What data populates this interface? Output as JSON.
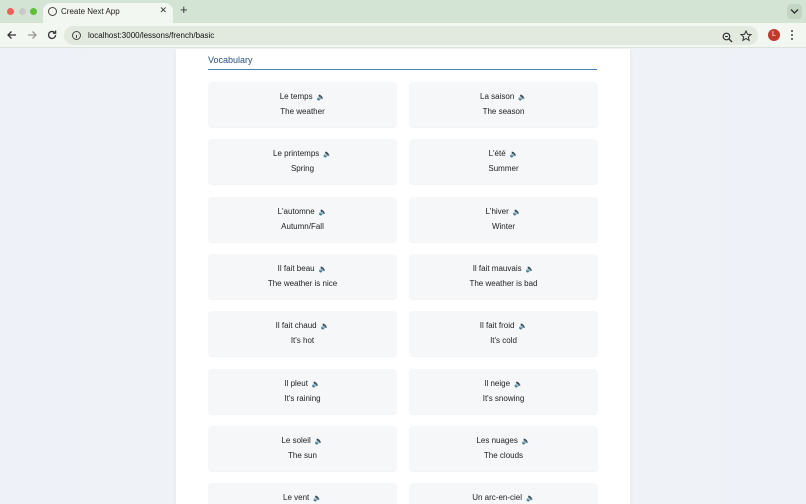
{
  "browser": {
    "tab_title": "Create Next App",
    "tab_close": "✕",
    "new_tab": "+",
    "url": "localhost:3000/lessons/french/basic",
    "profile_initial": "L"
  },
  "lesson": {
    "section_title": "Vocabulary",
    "speaker_icon": "🔈",
    "items": [
      {
        "fr": "Le temps",
        "en": "The weather"
      },
      {
        "fr": "La saison",
        "en": "The season"
      },
      {
        "fr": "Le printemps",
        "en": "Spring"
      },
      {
        "fr": "L'été",
        "en": "Summer"
      },
      {
        "fr": "L'automne",
        "en": "Autumn/Fall"
      },
      {
        "fr": "L'hiver",
        "en": "Winter"
      },
      {
        "fr": "Il fait beau",
        "en": "The weather is nice"
      },
      {
        "fr": "Il fait mauvais",
        "en": "The weather is bad"
      },
      {
        "fr": "Il fait chaud",
        "en": "It's hot"
      },
      {
        "fr": "Il fait froid",
        "en": "It's cold"
      },
      {
        "fr": "Il pleut",
        "en": "It's raining"
      },
      {
        "fr": "Il neige",
        "en": "It's snowing"
      },
      {
        "fr": "Le soleil",
        "en": "The sun"
      },
      {
        "fr": "Les nuages",
        "en": "The clouds"
      },
      {
        "fr": "Le vent",
        "en": ""
      },
      {
        "fr": "Un arc-en-ciel",
        "en": ""
      }
    ]
  },
  "colors": {
    "tab_strip": "#d3e3d4",
    "accent_line": "#4f7fae",
    "section_title": "#2c5282"
  }
}
